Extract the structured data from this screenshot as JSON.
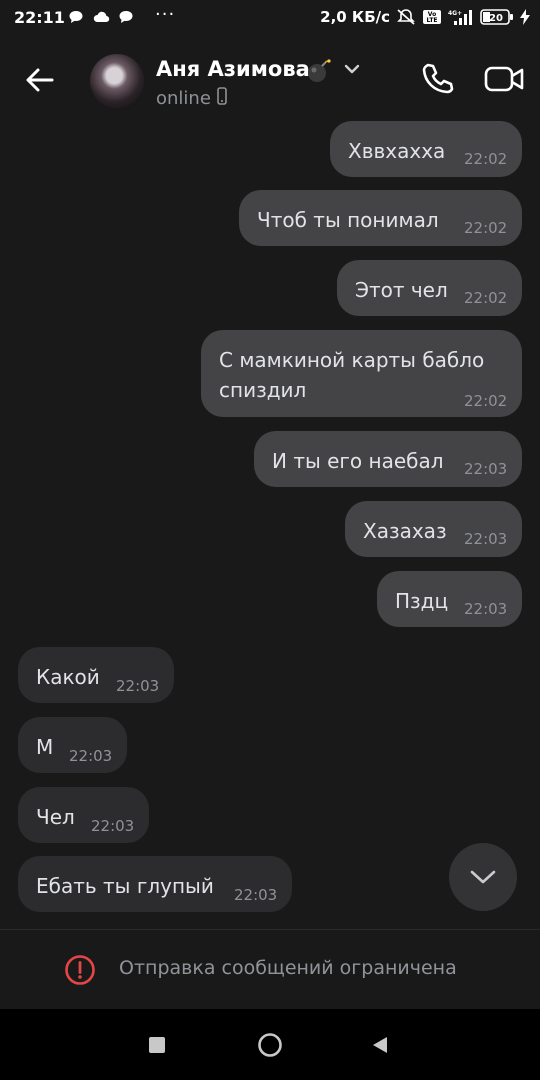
{
  "status_bar": {
    "time": "22:11",
    "dots": "···",
    "speed": "2,0 КБ/с",
    "battery": "20"
  },
  "header": {
    "contact_name": "Аня Азимова",
    "status": "online"
  },
  "messages": [
    {
      "text": "Хввхахха",
      "time": "22:02",
      "direction": "out"
    },
    {
      "text": "Чтоб ты понимал",
      "time": "22:02",
      "direction": "out"
    },
    {
      "text": "Этот чел",
      "time": "22:02",
      "direction": "out"
    },
    {
      "text": "С мамкиной карты бабло",
      "text2": "спиздил",
      "time": "22:02",
      "direction": "out"
    },
    {
      "text": "И ты его наебал",
      "time": "22:03",
      "direction": "out"
    },
    {
      "text": "Хазахаз",
      "time": "22:03",
      "direction": "out"
    },
    {
      "text": "Пздц",
      "time": "22:03",
      "direction": "out"
    },
    {
      "text": "Какой",
      "time": "22:03",
      "direction": "in"
    },
    {
      "text": "М",
      "time": "22:03",
      "direction": "in"
    },
    {
      "text": "Чел",
      "time": "22:03",
      "direction": "in"
    },
    {
      "text": "Ебать ты глупый",
      "time": "22:03",
      "direction": "in"
    }
  ],
  "footer": {
    "restriction_text": "Отправка сообщений ограничена"
  },
  "colors": {
    "background": "#19191a",
    "outgoing_bubble": "#444447",
    "incoming_bubble": "#2c2c2e",
    "warning_red": "#e64646"
  }
}
